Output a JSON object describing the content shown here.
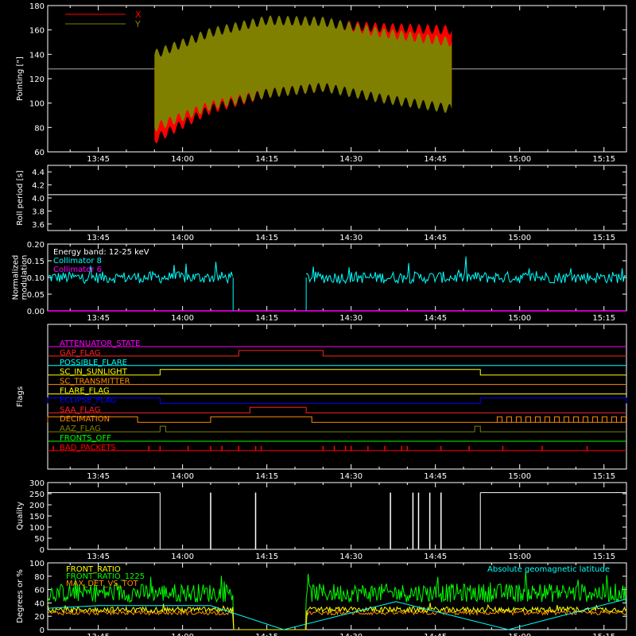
{
  "time_ticks": [
    "13:45",
    "14:00",
    "14:15",
    "14:30",
    "14:45",
    "15:00",
    "15:15"
  ],
  "colors": {
    "background": "#000000",
    "axes": "#ffffff",
    "red": "#ff0000",
    "olive": "#808000",
    "cyan": "#00ffff",
    "magenta": "#ff00ff",
    "yellow": "#ffff00",
    "green": "#00ff00",
    "orange": "#ff8c00"
  },
  "chart_data": [
    {
      "type": "area",
      "ylabel": "Pointing [\"]",
      "ylim": [
        60,
        180
      ],
      "yticks": [
        60,
        80,
        100,
        120,
        140,
        160,
        180
      ],
      "legend": [
        "X",
        "Y"
      ],
      "legend_position": "top-left",
      "reference_level": 128,
      "data_span": [
        "13:55",
        "14:48"
      ],
      "series": [
        {
          "name": "X",
          "color": "#ff0000",
          "x": [
            "13:55",
            "14:05",
            "14:15",
            "14:25",
            "14:35",
            "14:48"
          ],
          "upper": [
            130,
            150,
            162,
            165,
            162,
            160
          ],
          "lower": [
            70,
            95,
            108,
            113,
            108,
            104
          ]
        },
        {
          "name": "Y",
          "color": "#808000",
          "x": [
            "13:55",
            "14:05",
            "14:15",
            "14:25",
            "14:35",
            "14:48"
          ],
          "upper": [
            140,
            158,
            168,
            167,
            158,
            150
          ],
          "lower": [
            80,
            98,
            108,
            113,
            104,
            95
          ]
        }
      ]
    },
    {
      "type": "line",
      "ylabel": "Roll period [s]",
      "ylim": [
        3.5,
        4.5
      ],
      "yticks": [
        "3.6",
        "3.8",
        "4.0",
        "4.2",
        "4.4"
      ],
      "series": [
        {
          "name": "",
          "color": "#ffffff",
          "values": [
            4.05
          ]
        }
      ]
    },
    {
      "type": "line",
      "ylabel": [
        "Normalized",
        "modulation"
      ],
      "ylim": [
        0,
        0.2
      ],
      "yticks": [
        "0.00",
        "0.05",
        "0.10",
        "0.15",
        "0.20"
      ],
      "legend": [
        "Energy band: 12-25 keV",
        "Collimator 8",
        "Collimator 6"
      ],
      "series": [
        {
          "name": "Collimator 8",
          "color": "#00ffff",
          "mean": 0.1,
          "active_intervals": [
            [
              "13:36",
              "14:09"
            ],
            [
              "14:22",
              "15:19"
            ]
          ],
          "zero_interval": [
            "14:09",
            "14:22"
          ]
        },
        {
          "name": "Collimator 6",
          "color": "#ff00ff",
          "values": [
            0.0
          ]
        }
      ]
    },
    {
      "type": "line",
      "ylabel": "Flags",
      "flags": [
        {
          "name": "ATTENUATOR_STATE",
          "color": "#ff00ff",
          "on": []
        },
        {
          "name": "GAP_FLAG",
          "color": "#ff2222",
          "on": [
            [
              "14:10",
              "14:25"
            ]
          ]
        },
        {
          "name": "POSSIBLE_FLARE",
          "color": "#00ffff",
          "on": []
        },
        {
          "name": "SC_IN_SUNLIGHT",
          "color": "#ffff00",
          "on": [
            [
              "13:56",
              "14:53"
            ]
          ]
        },
        {
          "name": "SC_TRANSMITTER",
          "color": "#ff8c00",
          "on": []
        },
        {
          "name": "FLARE_FLAG",
          "color": "#ffff00",
          "on": []
        },
        {
          "name": "ECLIPSE_FLAG",
          "color": "#0000ff",
          "on": [
            [
              "13:36",
              "13:56"
            ],
            [
              "14:53",
              "15:19"
            ]
          ]
        },
        {
          "name": "SAA_FLAG",
          "color": "#ff2222",
          "on": [
            [
              "14:12",
              "14:22"
            ]
          ]
        },
        {
          "name": "DECIMATION",
          "color": "#ff8c00",
          "on": [
            [
              "13:36",
              "13:52"
            ],
            [
              "14:05",
              "14:23"
            ]
          ]
        },
        {
          "name": "AAZ_FLAG",
          "color": "#808000",
          "on": [
            [
              "13:56",
              "13:57"
            ],
            [
              "14:52",
              "14:53"
            ]
          ]
        },
        {
          "name": "FRONTS_OFF",
          "color": "#00ff00",
          "on": []
        },
        {
          "name": "BAD_PACKETS",
          "color": "#ff0000",
          "on": []
        }
      ],
      "bad_packet_times": [
        "13:37",
        "13:54",
        "13:56",
        "14:01",
        "14:05",
        "14:07",
        "14:10",
        "14:13",
        "14:14",
        "14:25",
        "14:27",
        "14:29",
        "14:30",
        "14:33",
        "14:36",
        "14:39",
        "14:40",
        "14:46",
        "14:51",
        "14:57",
        "15:04",
        "15:12"
      ]
    },
    {
      "type": "bar",
      "ylabel": "Quality",
      "ylim": [
        0,
        300
      ],
      "yticks": [
        0,
        50,
        100,
        150,
        200,
        250,
        300
      ],
      "high_level": 255,
      "segments": [
        [
          "13:36",
          "13:56"
        ],
        [
          "14:53",
          "15:19"
        ]
      ],
      "spikes": [
        "14:05",
        "14:13",
        "14:37",
        "14:41",
        "14:42",
        "14:44",
        "14:46"
      ]
    },
    {
      "type": "line",
      "ylabel": "Degrees or %",
      "ylim": [
        0,
        100
      ],
      "yticks": [
        0,
        20,
        40,
        60,
        80,
        100
      ],
      "legend": [
        "FRONT_RATIO",
        "FRONT_RATIO_1225",
        "MAX_DET_VS_TOT",
        "Absolute geomagnetic latitude"
      ],
      "series": [
        {
          "name": "FRONT_RATIO",
          "color": "#ffff00",
          "mean": 30
        },
        {
          "name": "FRONT_RATIO_1225",
          "color": "#00ff00",
          "mean": 55
        },
        {
          "name": "MAX_DET_VS_TOT",
          "color": "#ff8c00",
          "mean": 25
        },
        {
          "name": "Absolute geomagnetic latitude",
          "color": "#00ffff",
          "x": [
            "13:36",
            "13:45",
            "14:05",
            "14:18",
            "14:38",
            "14:58",
            "15:19"
          ],
          "values": [
            32,
            36,
            36,
            0,
            42,
            0,
            46
          ]
        }
      ]
    }
  ]
}
